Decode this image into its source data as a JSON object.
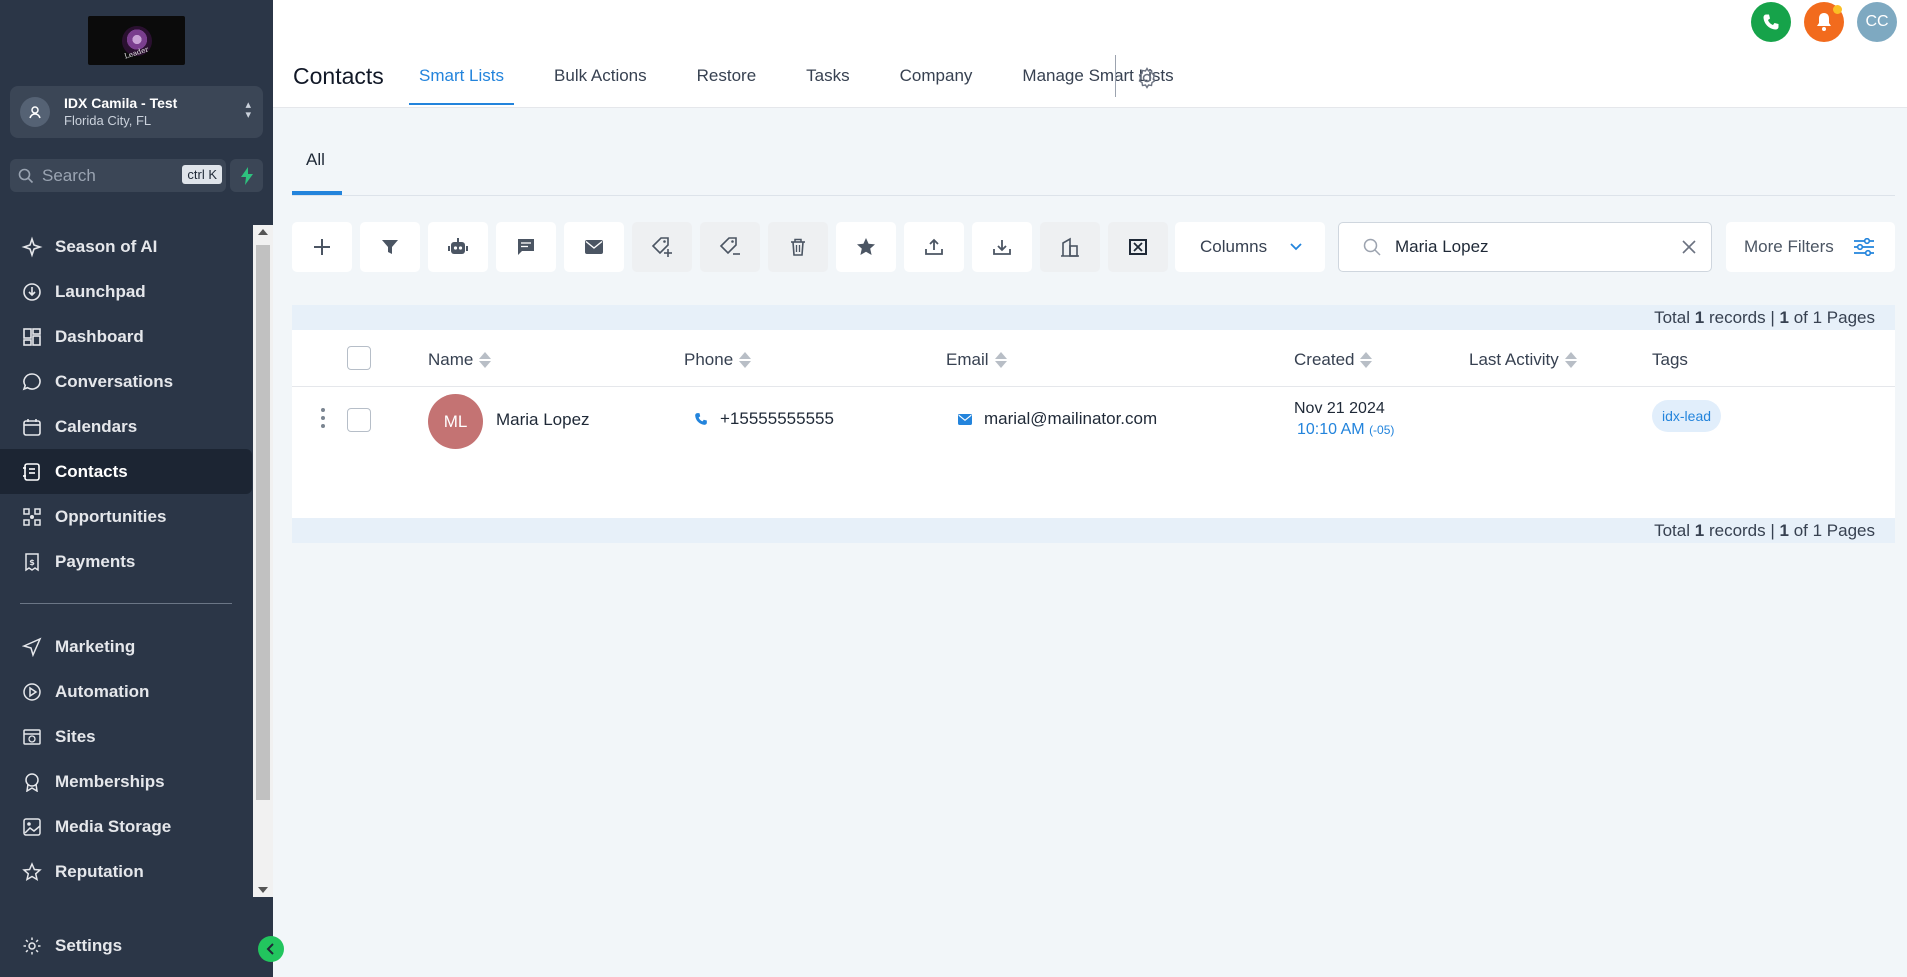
{
  "sidebar": {
    "account": {
      "name": "IDX Camila - Test",
      "location": "Florida City, FL"
    },
    "search": {
      "label": "Search",
      "shortcut": "ctrl K"
    },
    "items": [
      {
        "label": "Season of AI",
        "icon": "sparkle-icon"
      },
      {
        "label": "Launchpad",
        "icon": "rocket-icon"
      },
      {
        "label": "Dashboard",
        "icon": "dashboard-icon"
      },
      {
        "label": "Conversations",
        "icon": "chat-bubble-icon"
      },
      {
        "label": "Calendars",
        "icon": "calendar-icon"
      },
      {
        "label": "Contacts",
        "icon": "contacts-icon",
        "active": true
      },
      {
        "label": "Opportunities",
        "icon": "opportunities-icon"
      },
      {
        "label": "Payments",
        "icon": "payments-icon"
      }
    ],
    "items2": [
      {
        "label": "Marketing",
        "icon": "send-icon"
      },
      {
        "label": "Automation",
        "icon": "automation-icon"
      },
      {
        "label": "Sites",
        "icon": "sites-icon"
      },
      {
        "label": "Memberships",
        "icon": "award-icon"
      },
      {
        "label": "Media Storage",
        "icon": "image-icon"
      },
      {
        "label": "Reputation",
        "icon": "star-icon"
      }
    ],
    "settings_label": "Settings"
  },
  "header": {
    "title": "Contacts",
    "tabs": [
      "Smart Lists",
      "Bulk Actions",
      "Restore",
      "Tasks",
      "Company",
      "Manage Smart Lists"
    ],
    "active_tab": "Smart Lists",
    "avatar_initials": "CC"
  },
  "subtab": {
    "label": "All"
  },
  "toolbar": {
    "columns_label": "Columns",
    "search_value": "Maria Lopez",
    "more_filters_label": "More Filters"
  },
  "records": {
    "prefix": "Total",
    "count": "1",
    "mid": "records |",
    "page": "1",
    "suffix": "of 1 Pages"
  },
  "table": {
    "columns": [
      "Name",
      "Phone",
      "Email",
      "Created",
      "Last Activity",
      "Tags"
    ],
    "rows": [
      {
        "initials": "ML",
        "name": "Maria Lopez",
        "phone": "+15555555555",
        "email": "marial@mailinator.com",
        "created_date": "Nov 21 2024",
        "created_time": "10:10 AM",
        "created_tz": "(-05)",
        "tag": "idx-lead"
      }
    ]
  },
  "colors": {
    "accent": "#2384dc",
    "sidebar": "#2b3647",
    "avatar": "#c47373"
  }
}
